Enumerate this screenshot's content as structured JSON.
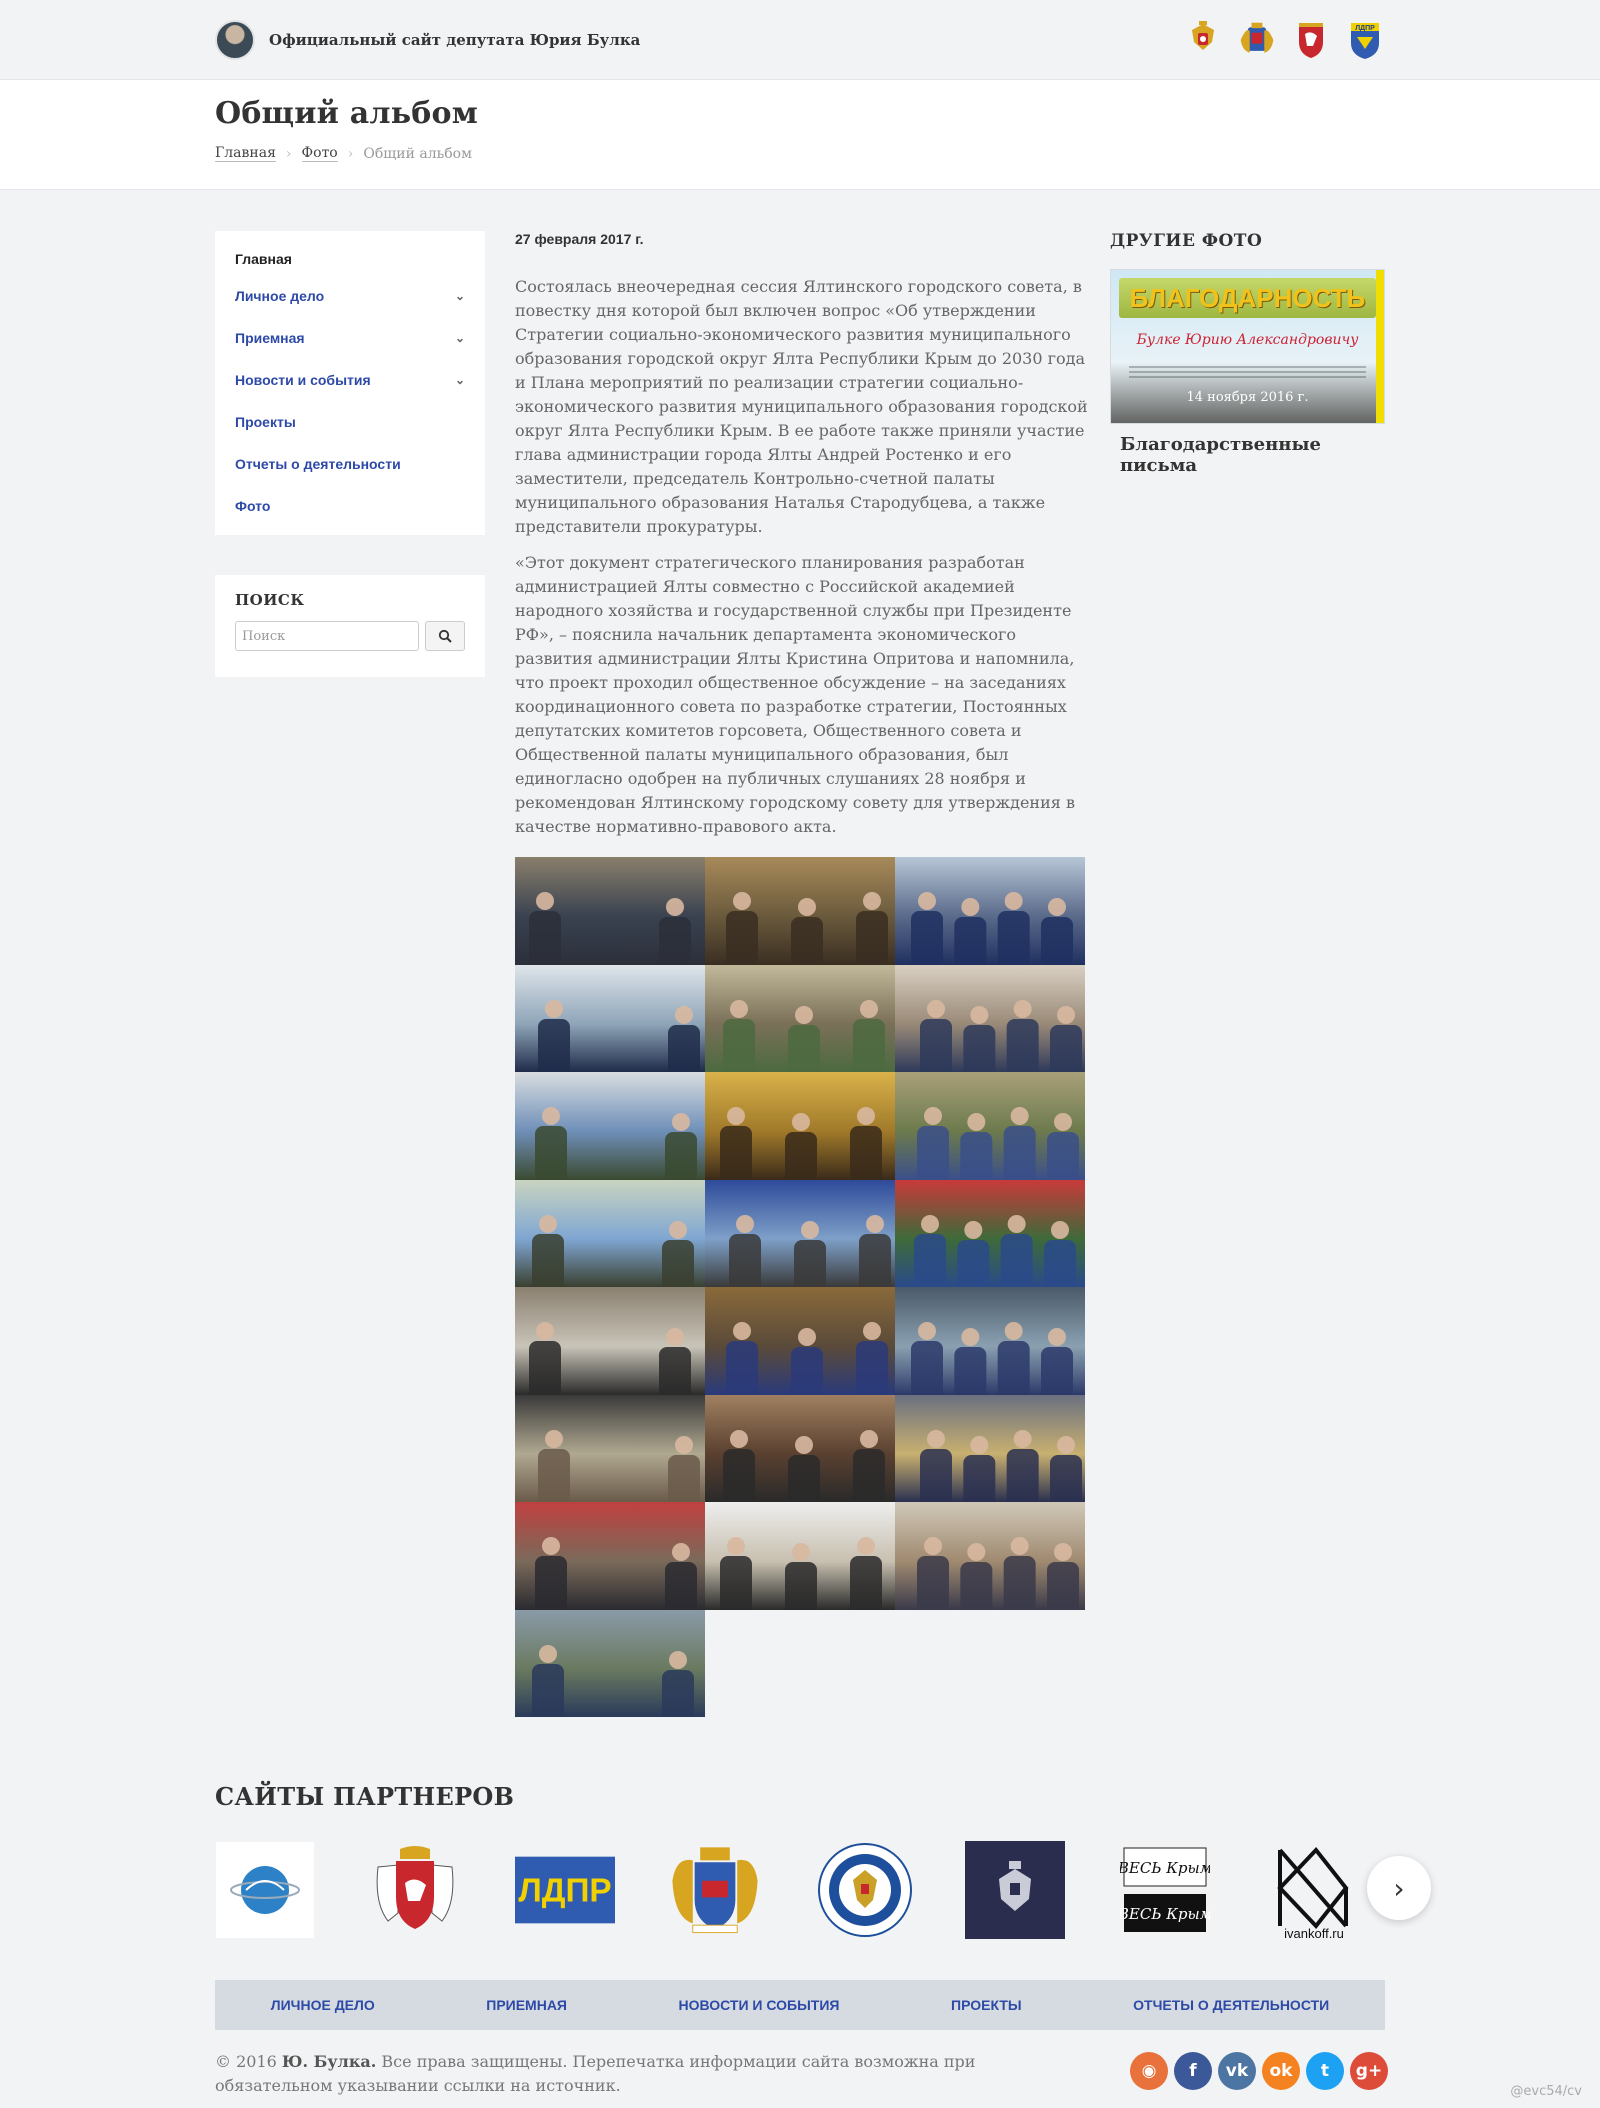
{
  "header": {
    "site_title": "Официальный сайт депутата Юрия Булка",
    "emblems": [
      "russia-coat-of-arms-icon",
      "yalta-coat-of-arms-icon",
      "crimea-coat-of-arms-icon",
      "ldpr-emblem-icon"
    ]
  },
  "page": {
    "title": "Общий альбом",
    "breadcrumb": [
      {
        "label": "Главная"
      },
      {
        "label": "Фото"
      },
      {
        "label": "Общий альбом"
      }
    ]
  },
  "sidebar": {
    "menu": [
      {
        "label": "Главная",
        "has_submenu": false
      },
      {
        "label": "Личное дело",
        "has_submenu": true
      },
      {
        "label": "Приемная",
        "has_submenu": true
      },
      {
        "label": "Новости и события",
        "has_submenu": true
      },
      {
        "label": "Проекты",
        "has_submenu": false
      },
      {
        "label": "Отчеты о деятельности",
        "has_submenu": false
      },
      {
        "label": "Фото",
        "has_submenu": false
      }
    ],
    "search": {
      "title": "ПОИСК",
      "placeholder": "Поиск"
    }
  },
  "article": {
    "date": "27 февраля 2017 г.",
    "paragraphs": [
      "Состоялась внеочередная сессия Ялтинского городского совета, в повестку дня которой был включен вопрос «Об утверждении Стратегии социально-экономического развития муниципального образования городской округ Ялта Республики Крым до 2030 года и Плана мероприятий по реализации стратегии социально-экономического развития муниципального образования городской округ Ялта Республики Крым. В ее работе также приняли участие глава администрации города Ялты Андрей Ростенко и его заместители, председатель Контрольно-счетной палаты муниципального образования Наталья Стародубцева, а также представители прокуратуры.",
      "«Этот документ стратегического планирования разработан администрацией Ялты совместно с Российской академией народного хозяйства и государственной службы при Президенте РФ», – пояснила начальник департамента экономического развития администрации Ялты Кристина Опритова и напомнила, что проект проходил общественное обсуждение – на заседаниях координационного совета по разработке стратегии, Постоянных депутатских комитетов горсовета, Общественного совета и Общественной палаты муниципального образования, был единогласно одобрен на публичных слушаниях 28 ноября и рекомендован Ялтинскому городскому совету для утверждения в качестве нормативно-правового акта."
    ],
    "photo_count": 22
  },
  "other_photos": {
    "title": "ДРУГИЕ ФОТО",
    "card": {
      "image_heading": "БЛАГОДАРНОСТЬ",
      "image_name": "Булке Юрию Александровичу",
      "date": "14 ноября 2016 г.",
      "caption": "Благодарственные письма"
    }
  },
  "partners": {
    "title": "САЙТЫ ПАРТНЕРОВ",
    "items": [
      {
        "name": "crimean-sputnik-logo",
        "label": ""
      },
      {
        "name": "crimea-coat-of-arms-logo",
        "label": ""
      },
      {
        "name": "ldpr-logo",
        "label": "ЛДПР"
      },
      {
        "name": "yalta-coat-of-arms-logo",
        "label": ""
      },
      {
        "name": "federal-tax-service-logo",
        "label": ""
      },
      {
        "name": "russian-eagle-logo",
        "label": ""
      },
      {
        "name": "ves-krym-logo",
        "label": "ВЕСЬ Крым"
      },
      {
        "name": "ivankoff-logo",
        "label": "ivankoff.ru"
      }
    ],
    "next_icon": "chevron-right-icon"
  },
  "footer": {
    "nav": [
      "ЛИЧНОЕ ДЕЛО",
      "ПРИЕМНАЯ",
      "НОВОСТИ И СОБЫТИЯ",
      "ПРОЕКТЫ",
      "ОТЧЕТЫ О ДЕЯТЕЛЬНОСТИ"
    ],
    "copyright_prefix": "© 2016",
    "copyright_owner": "Ю. Булка.",
    "copyright_text": "Все права защищены. Перепечатка информации сайта возможна при обязательном указывании ссылки на источник.",
    "socials": [
      {
        "name": "rss-icon",
        "glyph": "◉",
        "color": "#e8713c"
      },
      {
        "name": "facebook-icon",
        "glyph": "f",
        "color": "#3b5998"
      },
      {
        "name": "vk-icon",
        "glyph": "vk",
        "color": "#4c75a3"
      },
      {
        "name": "odnoklassniki-icon",
        "glyph": "ok",
        "color": "#f58220"
      },
      {
        "name": "twitter-icon",
        "glyph": "t",
        "color": "#1da1f2"
      },
      {
        "name": "google-plus-icon",
        "glyph": "g+",
        "color": "#dd4b39"
      }
    ]
  },
  "watermark": "@evc54/cv"
}
